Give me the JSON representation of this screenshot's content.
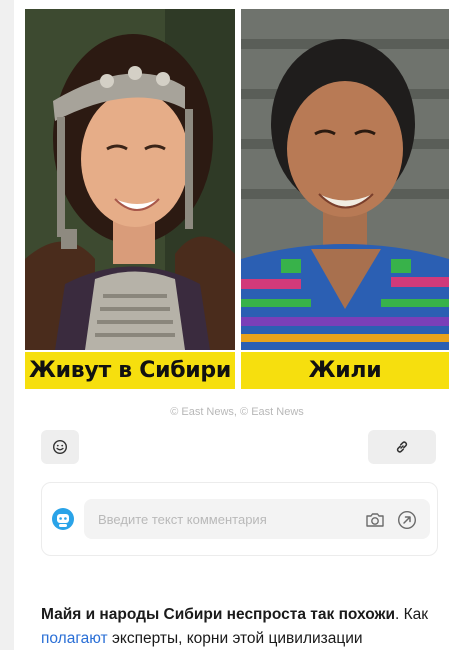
{
  "images": [
    {
      "caption": "Живут в Сибири"
    },
    {
      "caption": "Жили"
    }
  ],
  "photo_credit": "© East News, © East News",
  "actions": {
    "emoji_icon": "smiley-icon",
    "link_icon": "link-icon"
  },
  "comment": {
    "placeholder": "Введите текст комментария",
    "camera_icon": "camera-icon",
    "send_icon": "send-arrow-icon",
    "avatar_icon": "robot-avatar-icon"
  },
  "article": {
    "bold_lead": "Майя и народы Сибири неспроста так похожи",
    "after_bold": ". Как",
    "link_text": "полагают",
    "line_rest": " эксперты, корни этой цивилизации"
  },
  "colors": {
    "caption_yellow": "#f6df0e",
    "link_blue": "#2a6fd6",
    "avatar_blue": "#2aa3e8"
  }
}
